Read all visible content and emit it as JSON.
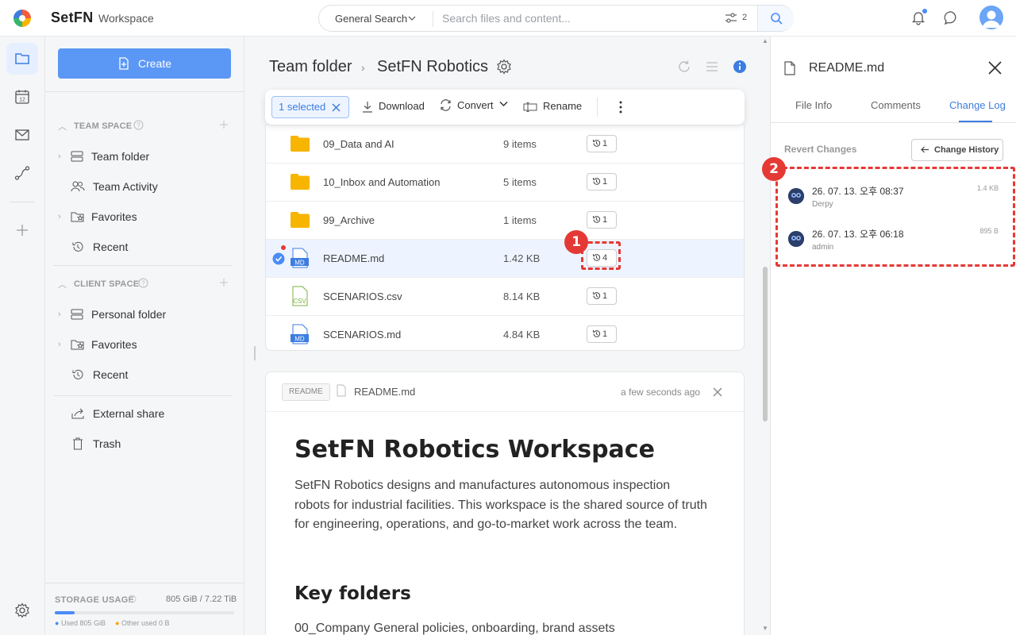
{
  "app": {
    "brand": "SetFN",
    "workspace": "Workspace"
  },
  "search": {
    "scope": "General Search",
    "placeholder": "Search files and content...",
    "filter_count": "2"
  },
  "sidebar": {
    "create_label": "Create",
    "team_space": {
      "title": "TEAM SPACE",
      "items": [
        "Team folder",
        "Team Activity",
        "Favorites",
        "Recent"
      ]
    },
    "client_space": {
      "title": "CLIENT SPACE",
      "items": [
        "Personal folder",
        "Favorites",
        "Recent"
      ]
    },
    "other": [
      "External share",
      "Trash"
    ],
    "storage": {
      "label": "STORAGE USAGE",
      "value": "805 GiB / 7.22 TiB",
      "used_fraction": 0.11,
      "used_legend": "Used 805 GiB",
      "other_legend": "Other used 0 B"
    }
  },
  "breadcrumb": {
    "parent": "Team folder",
    "current": "SetFN Robotics"
  },
  "toolbar": {
    "selected": "1 selected",
    "download": "Download",
    "convert": "Convert",
    "rename": "Rename"
  },
  "files": [
    {
      "name": "09_Data and AI",
      "size": "9 items",
      "versions": "1",
      "type": "folder"
    },
    {
      "name": "10_Inbox and Automation",
      "size": "5 items",
      "versions": "1",
      "type": "folder"
    },
    {
      "name": "99_Archive",
      "size": "1 items",
      "versions": "1",
      "type": "folder"
    },
    {
      "name": "README.md",
      "size": "1.42 KB",
      "versions": "4",
      "type": "md"
    },
    {
      "name": "SCENARIOS.csv",
      "size": "8.14 KB",
      "versions": "1",
      "type": "csv"
    },
    {
      "name": "SCENARIOS.md",
      "size": "4.84 KB",
      "versions": "1",
      "type": "md"
    }
  ],
  "preview": {
    "tag": "README",
    "filename": "README.md",
    "time": "a few seconds ago",
    "h1": "SetFN Robotics Workspace",
    "paragraph": "SetFN Robotics designs and manufactures autonomous inspection robots for industrial facilities. This workspace is the shared source of truth for engineering, operations, and go-to-market work across the team.",
    "h2": "Key folders",
    "line1": "00_Company General policies, onboarding, brand assets"
  },
  "panel": {
    "title": "README.md",
    "tabs": [
      "File Info",
      "Comments",
      "Change Log"
    ],
    "active_tab": "Change Log",
    "revert_label": "Revert Changes",
    "change_history": "Change History",
    "entries": [
      {
        "date": "26. 07. 13. 오후 08:37",
        "user": "Derpy",
        "size": "1.4 KB"
      },
      {
        "date": "26. 07. 13. 오후 06:18",
        "user": "admin",
        "size": "895 B"
      }
    ]
  },
  "annotations": {
    "marker1": "1",
    "marker2": "2"
  },
  "colors": {
    "accent": "#4a8cf7",
    "folder": "#f7b500",
    "annotation": "#e53935"
  }
}
